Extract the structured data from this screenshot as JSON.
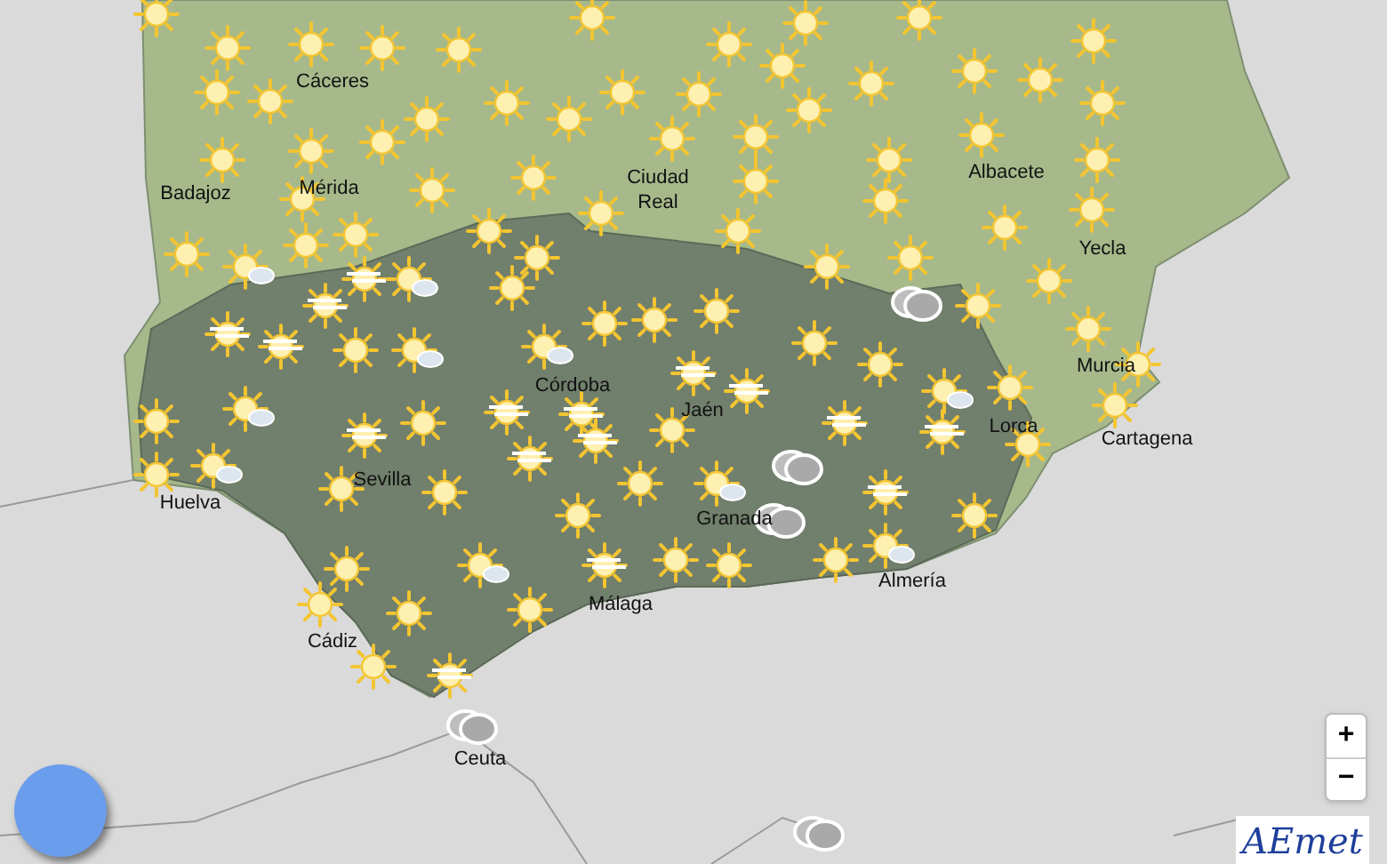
{
  "map": {
    "cities": [
      {
        "name": "Cáceres"
      },
      {
        "name": "Badajoz"
      },
      {
        "name": "Mérida"
      },
      {
        "name": "Ciudad\nReal"
      },
      {
        "name": "Albacete"
      },
      {
        "name": "Yecla"
      },
      {
        "name": "Murcia"
      },
      {
        "name": "Cartagena"
      },
      {
        "name": "Lorca"
      },
      {
        "name": "Córdoba"
      },
      {
        "name": "Jaén"
      },
      {
        "name": "Sevilla"
      },
      {
        "name": "Huelva"
      },
      {
        "name": "Granada"
      },
      {
        "name": "Almería"
      },
      {
        "name": "Málaga"
      },
      {
        "name": "Cádiz"
      },
      {
        "name": "Ceuta"
      }
    ],
    "weather_icons": [
      {
        "kind": "sun"
      },
      {
        "kind": "sun"
      },
      {
        "kind": "sun"
      },
      {
        "kind": "sun"
      },
      {
        "kind": "sun"
      },
      {
        "kind": "sun"
      },
      {
        "kind": "sun"
      },
      {
        "kind": "sun"
      },
      {
        "kind": "sun"
      },
      {
        "kind": "sun"
      },
      {
        "kind": "sun"
      },
      {
        "kind": "sun"
      },
      {
        "kind": "sun"
      },
      {
        "kind": "sun"
      },
      {
        "kind": "sun"
      },
      {
        "kind": "sun"
      },
      {
        "kind": "sun"
      },
      {
        "kind": "sun"
      },
      {
        "kind": "sun"
      },
      {
        "kind": "sun"
      },
      {
        "kind": "sun"
      },
      {
        "kind": "sun"
      },
      {
        "kind": "sun"
      },
      {
        "kind": "sun"
      },
      {
        "kind": "sun"
      },
      {
        "kind": "sun"
      },
      {
        "kind": "sun"
      },
      {
        "kind": "sun"
      },
      {
        "kind": "sun"
      },
      {
        "kind": "sun"
      },
      {
        "kind": "sun"
      },
      {
        "kind": "sun"
      },
      {
        "kind": "sun"
      },
      {
        "kind": "sun"
      },
      {
        "kind": "sun"
      },
      {
        "kind": "sun"
      },
      {
        "kind": "sun"
      },
      {
        "kind": "sun"
      },
      {
        "kind": "sun"
      },
      {
        "kind": "sun"
      },
      {
        "kind": "sun"
      },
      {
        "kind": "sun"
      },
      {
        "kind": "sun"
      },
      {
        "kind": "sun"
      },
      {
        "kind": "sun"
      },
      {
        "kind": "sun"
      },
      {
        "kind": "sun_cloud"
      },
      {
        "kind": "sun_fog"
      },
      {
        "kind": "sun_cloud"
      },
      {
        "kind": "sun"
      },
      {
        "kind": "sun"
      },
      {
        "kind": "sun_fog"
      },
      {
        "kind": "sun_fog"
      },
      {
        "kind": "sun_fog"
      },
      {
        "kind": "sun"
      },
      {
        "kind": "sun_cloud"
      },
      {
        "kind": "sun_cloud"
      },
      {
        "kind": "sun"
      },
      {
        "kind": "sun"
      },
      {
        "kind": "sun"
      },
      {
        "kind": "sun"
      },
      {
        "kind": "sun"
      },
      {
        "kind": "sun"
      },
      {
        "kind": "sun"
      },
      {
        "kind": "cloud"
      },
      {
        "kind": "sun"
      },
      {
        "kind": "sun"
      },
      {
        "kind": "sun_cloud"
      },
      {
        "kind": "sun"
      },
      {
        "kind": "sun_fog"
      },
      {
        "kind": "sun_fog"
      },
      {
        "kind": "sun_fog"
      },
      {
        "kind": "sun_fog"
      },
      {
        "kind": "sun_fog"
      },
      {
        "kind": "sun"
      },
      {
        "kind": "sun_fog"
      },
      {
        "kind": "sun_fog"
      },
      {
        "kind": "sun"
      },
      {
        "kind": "sun_cloud"
      },
      {
        "kind": "sun"
      },
      {
        "kind": "sun"
      },
      {
        "kind": "sun"
      },
      {
        "kind": "sun_cloud"
      },
      {
        "kind": "sun"
      },
      {
        "kind": "sun"
      },
      {
        "kind": "sun_fog"
      },
      {
        "kind": "sun_fog"
      },
      {
        "kind": "sun"
      },
      {
        "kind": "sun_cloud"
      },
      {
        "kind": "cloud"
      },
      {
        "kind": "sun_fog"
      },
      {
        "kind": "sun"
      },
      {
        "kind": "cloud"
      },
      {
        "kind": "sun"
      },
      {
        "kind": "sun"
      },
      {
        "kind": "sun"
      },
      {
        "kind": "sun_cloud"
      },
      {
        "kind": "sun"
      },
      {
        "kind": "sun"
      },
      {
        "kind": "sun_fog"
      },
      {
        "kind": "sun_cloud"
      },
      {
        "kind": "sun"
      },
      {
        "kind": "sun"
      },
      {
        "kind": "sun"
      },
      {
        "kind": "sun"
      },
      {
        "kind": "sun"
      },
      {
        "kind": "sun_fog"
      },
      {
        "kind": "cloud"
      },
      {
        "kind": "cloud"
      }
    ]
  },
  "zoom_controls": {
    "zoom_in": "+",
    "zoom_out": "−"
  },
  "logo": {
    "text": "AEmet"
  }
}
